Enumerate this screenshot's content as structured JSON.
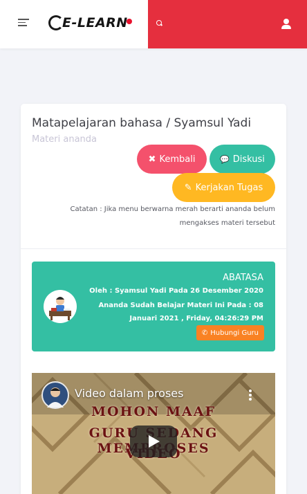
{
  "header": {
    "logo_text": "E-LEARN",
    "colors": {
      "accent": "#e52f3e",
      "logo_dot": "#e8112d"
    },
    "icons": [
      "menu-icon",
      "search-icon",
      "user-icon"
    ]
  },
  "card": {
    "title": "Matapelajaran bahasa / Syamsul Yadi",
    "subtitle": "Materi ananda",
    "buttons": {
      "kembali": {
        "icon": "✖",
        "label": "Kembali"
      },
      "diskusi": {
        "icon": "💬",
        "label": "Diskusi"
      },
      "tugas": {
        "icon": "✎",
        "label": "Kerjakan Tugas"
      }
    },
    "note": "Catatan : Jika menu berwarna merah berarti ananda belum mengakses materi tersebut"
  },
  "info": {
    "title": "ABATASA",
    "by": "Oleh : Syamsul Yadi Pada 26 Desember 2020",
    "status": "Ananda Sudah Belajar Materi Ini Pada : 08 Januari 2021 , Friday, 04:26:29 PM",
    "contact_button": {
      "icon": "✆",
      "label": "Hubungi Guru"
    }
  },
  "video": {
    "title": "Video dalam proses",
    "lines": [
      "MOHON MAAF",
      "GURU SEDANG MEMPROSES",
      "VIDEO"
    ]
  }
}
